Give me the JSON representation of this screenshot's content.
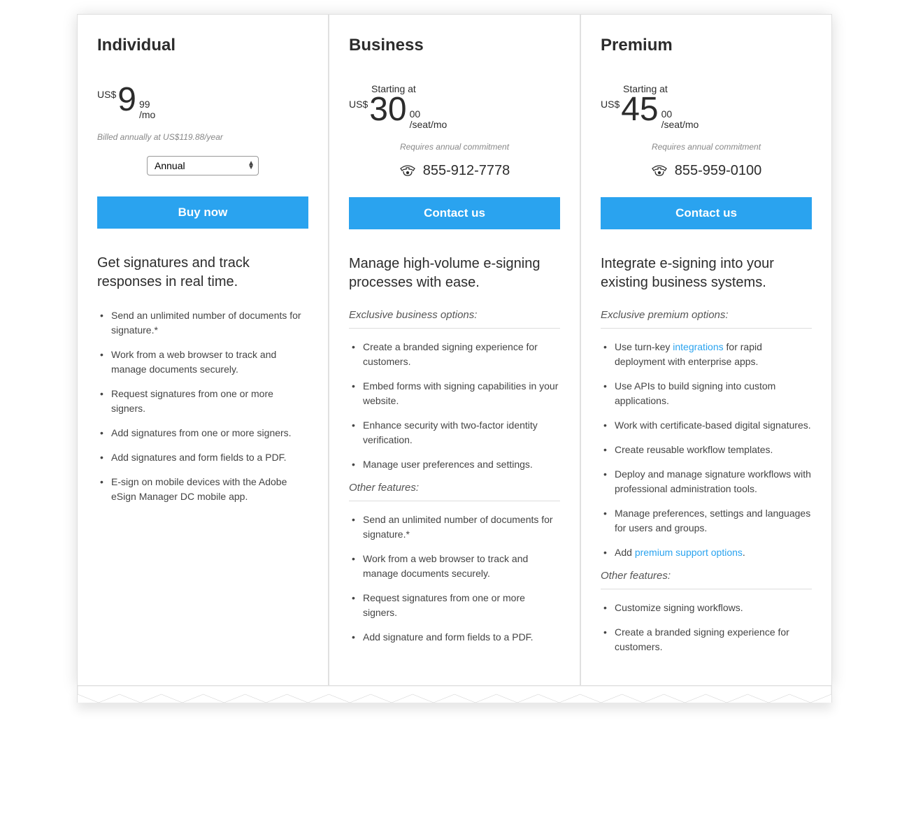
{
  "plans": [
    {
      "title": "Individual",
      "starting_at": "",
      "currency": "US$",
      "price_main": "9",
      "price_cents": "99",
      "price_unit": "/mo",
      "billed_note": "Billed annually at US$119.88/year",
      "commitment_note": "",
      "dropdown": {
        "options": [
          "Annual"
        ],
        "selected": "Annual"
      },
      "phone": "",
      "cta": "Buy now",
      "headline": "Get signatures and track responses in real time.",
      "sections": [
        {
          "label": "",
          "items": [
            {
              "text": "Send an unlimited number of documents for signature.*"
            },
            {
              "text": "Work from a web browser to track and manage documents securely."
            },
            {
              "text": "Request signatures from one or more signers."
            },
            {
              "text": "Add signatures from one or more signers."
            },
            {
              "text": "Add signatures and form fields to a PDF."
            },
            {
              "text": "E-sign on mobile devices with the Adobe eSign Manager DC mobile app."
            }
          ]
        }
      ]
    },
    {
      "title": "Business",
      "starting_at": "Starting at",
      "currency": "US$",
      "price_main": "30",
      "price_cents": "00",
      "price_unit": "/seat/mo",
      "billed_note": "",
      "commitment_note": "Requires annual commitment",
      "dropdown": null,
      "phone": "855-912-7778",
      "cta": "Contact us",
      "headline": "Manage high-volume e-signing processes with ease.",
      "sections": [
        {
          "label": "Exclusive business options:",
          "items": [
            {
              "text": "Create a branded signing experience for customers."
            },
            {
              "text": "Embed forms with signing capabilities in your website."
            },
            {
              "text": "Enhance security with two-factor identity verification."
            },
            {
              "text": "Manage user preferences and settings."
            }
          ]
        },
        {
          "label": "Other features:",
          "items": [
            {
              "text": "Send an unlimited number of documents for signature.*"
            },
            {
              "text": "Work from a web browser to track and manage documents securely."
            },
            {
              "text": "Request signatures from one or more signers."
            },
            {
              "text": "Add signature and form fields to a PDF."
            }
          ]
        }
      ]
    },
    {
      "title": "Premium",
      "starting_at": "Starting at",
      "currency": "US$",
      "price_main": "45",
      "price_cents": "00",
      "price_unit": "/seat/mo",
      "billed_note": "",
      "commitment_note": "Requires annual commitment",
      "dropdown": null,
      "phone": "855-959-0100",
      "cta": "Contact us",
      "headline": "Integrate e-signing into your existing business systems.",
      "sections": [
        {
          "label": "Exclusive premium options:",
          "items": [
            {
              "text_before": "Use turn-key ",
              "link": "integrations",
              "text_after": " for rapid deployment with enterprise apps."
            },
            {
              "text": "Use APIs to build signing into custom applications."
            },
            {
              "text": "Work with certificate-based digital signatures."
            },
            {
              "text": "Create reusable workflow templates."
            },
            {
              "text": "Deploy and manage signature workflows with professional administration tools."
            },
            {
              "text": "Manage preferences, settings and languages for users and groups."
            },
            {
              "text_before": "Add ",
              "link": "premium support options",
              "text_after": "."
            }
          ]
        },
        {
          "label": "Other features:",
          "items": [
            {
              "text": "Customize signing workflows."
            },
            {
              "text": "Create a branded signing experience for customers."
            }
          ]
        }
      ]
    }
  ],
  "colors": {
    "accent": "#2aa3ef"
  }
}
